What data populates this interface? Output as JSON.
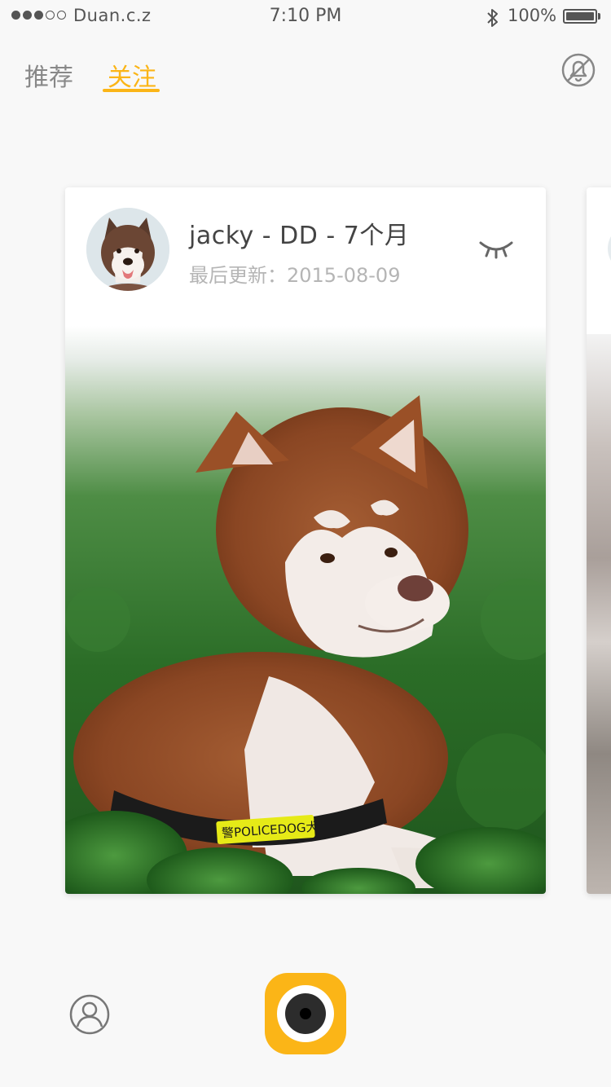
{
  "status_bar": {
    "carrier": "Duan.c.z",
    "time": "7:10 PM",
    "battery_percent": "100%",
    "signal_bars_filled": 3,
    "signal_bars_total": 5
  },
  "tabs": [
    {
      "label": "推荐",
      "active": false
    },
    {
      "label": "关注",
      "active": true
    }
  ],
  "header_icon": "bell-off-icon",
  "card": {
    "title": "jacky - DD - 7个月",
    "updated": "最后更新：2015-08-09",
    "action_icon": "closed-eye-icon",
    "photo_badge": "警POLICEDOG犬"
  },
  "bottom_bar": {
    "profile_icon": "person-icon",
    "camera_icon": "camera-icon"
  },
  "colors": {
    "accent": "#fbb517",
    "text_primary": "#444444",
    "text_secondary": "#b5b5b5",
    "tab_inactive": "#888888"
  }
}
